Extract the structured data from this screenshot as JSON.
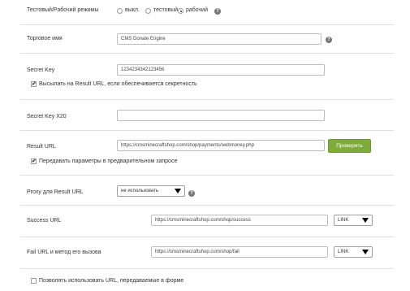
{
  "mode": {
    "label": "Тестовый/Рабочий режимы",
    "options": [
      "выкл.",
      "тестовый",
      "рабочий"
    ],
    "selected": "рабочий"
  },
  "trade_name": {
    "label": "Торговое имя",
    "value": "CMS Donate Engine"
  },
  "secret_key": {
    "label": "Secret Key",
    "value": "1234234342123456",
    "send_checkbox_label": "Высылать на Result URL, если обеспечивается секретность",
    "send_checked": true
  },
  "secret_key_x20": {
    "label": "Secret Key X20",
    "value": ""
  },
  "result_url": {
    "label": "Result URL",
    "value": "https://cmsminecraftshop.com/shop/payments/webmoney.php",
    "check_button": "Проверить",
    "prerequest_label": "Передавать параметры в предварительном запросе",
    "prerequest_checked": true
  },
  "proxy": {
    "label": "Proxy для Result URL",
    "selected": "не использовать"
  },
  "success_url": {
    "label": "Success URL",
    "value": "https://cmsminecraftshop.com/shop/success",
    "method": "LINK"
  },
  "fail_url": {
    "label": "Fail URL и метод его вызова",
    "value": "https://cmsminecraftshop.com/shop/fail",
    "method": "LINK"
  },
  "allow_form_urls": {
    "label": "Позволять использовать URL, передаваемые в форме",
    "checked": false
  },
  "colors": {
    "accent_button": "#7fab3a",
    "separator": "#e0e0e0"
  },
  "icons": {
    "help": "help-icon",
    "dropdown": "chevron-down-icon",
    "checkmark": "checkmark-icon"
  }
}
